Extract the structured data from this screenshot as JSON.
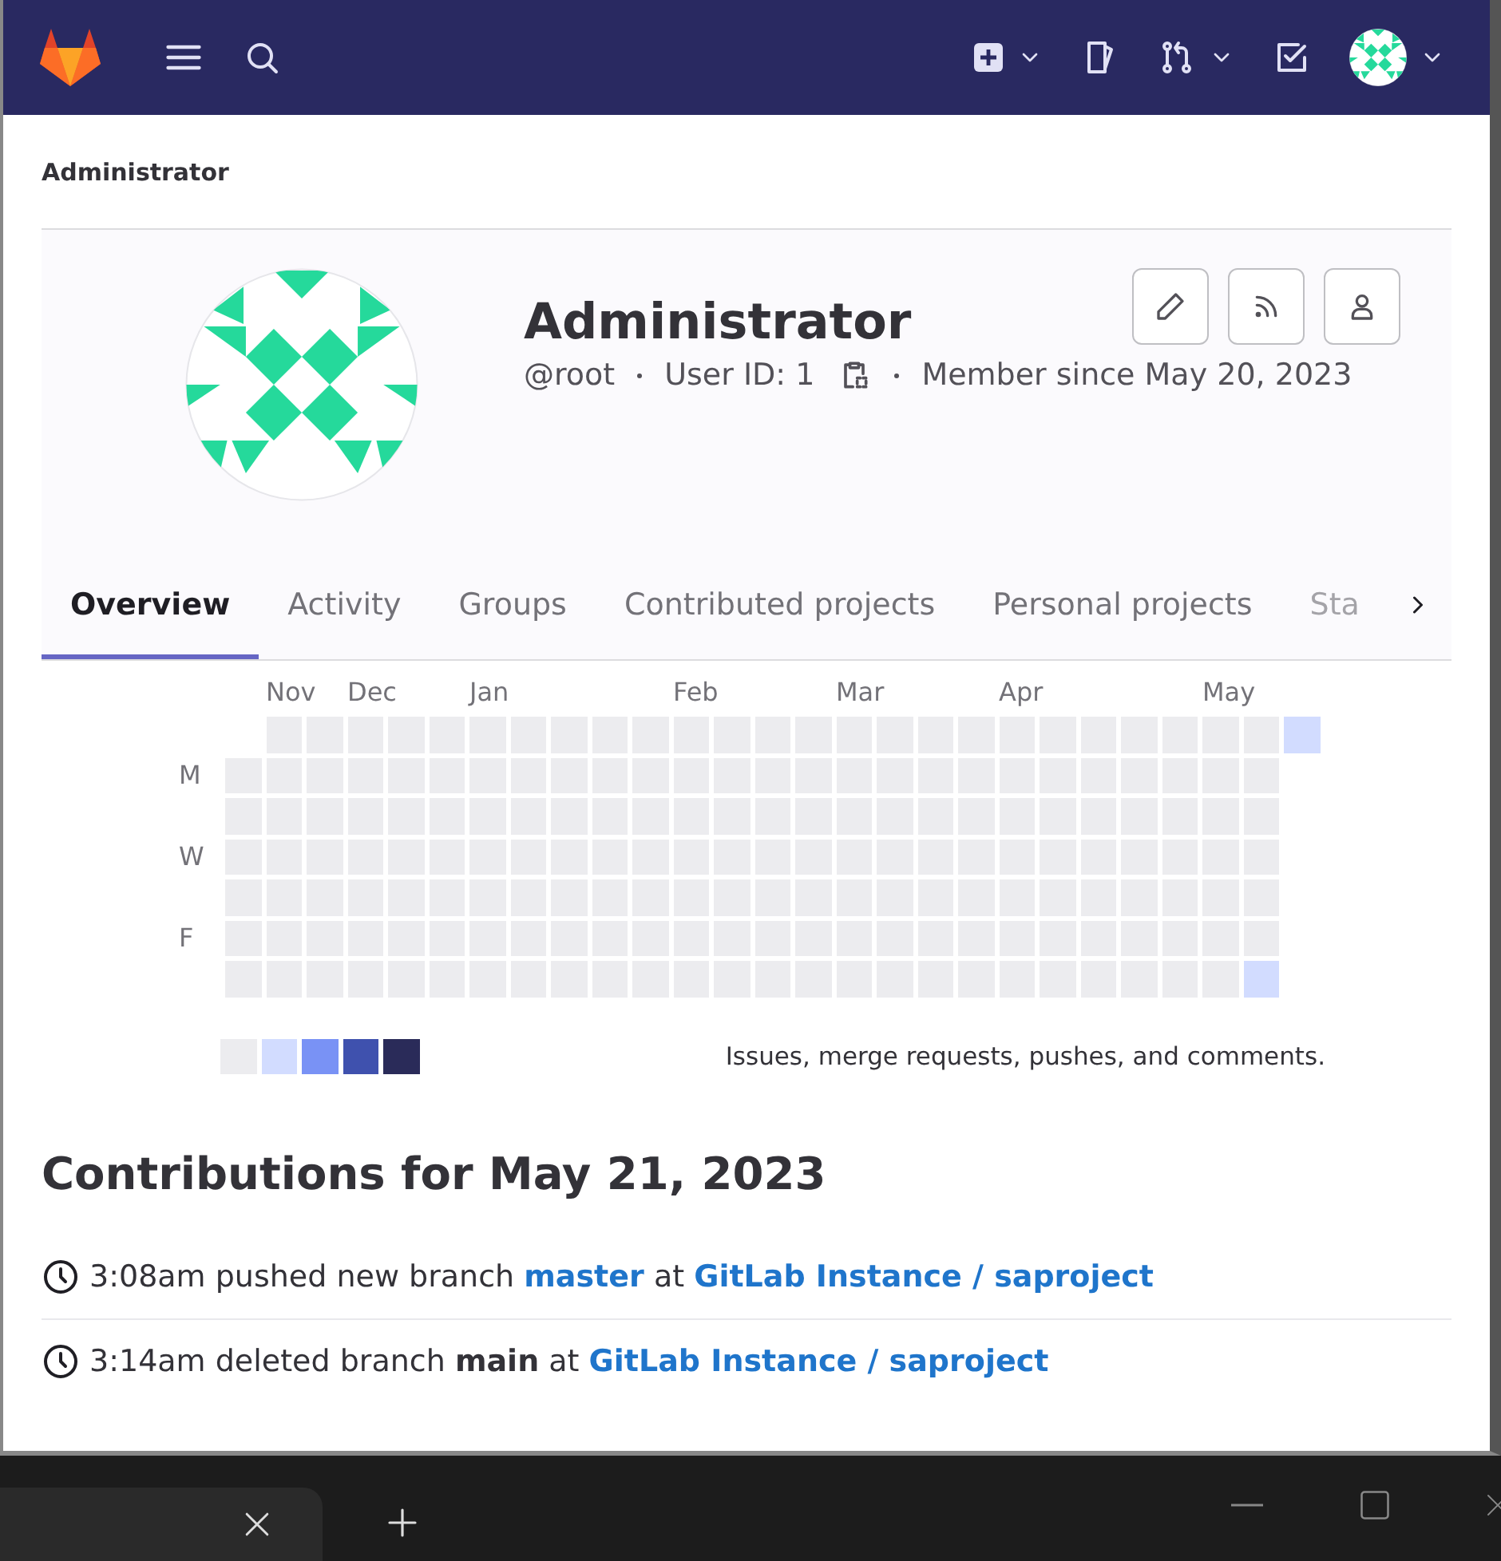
{
  "breadcrumb": "Administrator",
  "profile": {
    "name": "Administrator",
    "username": "@root",
    "user_id": "User ID: 1",
    "member_since": "Member since May 20, 2023"
  },
  "tabs": [
    {
      "label": "Overview",
      "selected": true
    },
    {
      "label": "Activity",
      "selected": false
    },
    {
      "label": "Groups",
      "selected": false
    },
    {
      "label": "Contributed projects",
      "selected": false
    },
    {
      "label": "Personal projects",
      "selected": false
    },
    {
      "label": "Sta",
      "selected": false
    }
  ],
  "calendar": {
    "day_labels": [
      "M",
      "W",
      "F"
    ],
    "weeks": [
      {
        "days": [
          {
            "color": "#ececef"
          },
          {
            "color": "#ececef"
          },
          {
            "color": "#ececef"
          },
          {
            "color": "#ececef"
          },
          {
            "color": "#ececef"
          },
          {
            "color": "#ececef"
          }
        ]
      },
      {
        "month": "Nov",
        "days": [
          {
            "color": "#ececef"
          },
          {
            "color": "#ececef"
          },
          {
            "color": "#ececef"
          },
          {
            "color": "#ececef"
          },
          {
            "color": "#ececef"
          },
          {
            "color": "#ececef"
          },
          {
            "color": "#ececef"
          }
        ]
      },
      {
        "days": [
          {
            "color": "#ececef"
          },
          {
            "color": "#ececef"
          },
          {
            "color": "#ececef"
          },
          {
            "color": "#ececef"
          },
          {
            "color": "#ececef"
          },
          {
            "color": "#ececef"
          },
          {
            "color": "#ececef"
          }
        ]
      },
      {
        "month": "Dec",
        "days": [
          {
            "color": "#ececef"
          },
          {
            "color": "#ececef"
          },
          {
            "color": "#ececef"
          },
          {
            "color": "#ececef"
          },
          {
            "color": "#ececef"
          },
          {
            "color": "#ececef"
          },
          {
            "color": "#ececef"
          }
        ]
      },
      {
        "days": [
          {
            "color": "#ececef"
          },
          {
            "color": "#ececef"
          },
          {
            "color": "#ececef"
          },
          {
            "color": "#ececef"
          },
          {
            "color": "#ececef"
          },
          {
            "color": "#ececef"
          },
          {
            "color": "#ececef"
          }
        ]
      },
      {
        "days": [
          {
            "color": "#ececef"
          },
          {
            "color": "#ececef"
          },
          {
            "color": "#ececef"
          },
          {
            "color": "#ececef"
          },
          {
            "color": "#ececef"
          },
          {
            "color": "#ececef"
          },
          {
            "color": "#ececef"
          }
        ]
      },
      {
        "month": "Jan",
        "days": [
          {
            "color": "#ececef"
          },
          {
            "color": "#ececef"
          },
          {
            "color": "#ececef"
          },
          {
            "color": "#ececef"
          },
          {
            "color": "#ececef"
          },
          {
            "color": "#ececef"
          },
          {
            "color": "#ececef"
          }
        ]
      },
      {
        "days": [
          {
            "color": "#ececef"
          },
          {
            "color": "#ececef"
          },
          {
            "color": "#ececef"
          },
          {
            "color": "#ececef"
          },
          {
            "color": "#ececef"
          },
          {
            "color": "#ececef"
          },
          {
            "color": "#ececef"
          }
        ]
      },
      {
        "days": [
          {
            "color": "#ececef"
          },
          {
            "color": "#ececef"
          },
          {
            "color": "#ececef"
          },
          {
            "color": "#ececef"
          },
          {
            "color": "#ececef"
          },
          {
            "color": "#ececef"
          },
          {
            "color": "#ececef"
          }
        ]
      },
      {
        "days": [
          {
            "color": "#ececef"
          },
          {
            "color": "#ececef"
          },
          {
            "color": "#ececef"
          },
          {
            "color": "#ececef"
          },
          {
            "color": "#ececef"
          },
          {
            "color": "#ececef"
          },
          {
            "color": "#ececef"
          }
        ]
      },
      {
        "days": [
          {
            "color": "#ececef"
          },
          {
            "color": "#ececef"
          },
          {
            "color": "#ececef"
          },
          {
            "color": "#ececef"
          },
          {
            "color": "#ececef"
          },
          {
            "color": "#ececef"
          },
          {
            "color": "#ececef"
          }
        ]
      },
      {
        "month": "Feb",
        "days": [
          {
            "color": "#ececef"
          },
          {
            "color": "#ececef"
          },
          {
            "color": "#ececef"
          },
          {
            "color": "#ececef"
          },
          {
            "color": "#ececef"
          },
          {
            "color": "#ececef"
          },
          {
            "color": "#ececef"
          }
        ]
      },
      {
        "days": [
          {
            "color": "#ececef"
          },
          {
            "color": "#ececef"
          },
          {
            "color": "#ececef"
          },
          {
            "color": "#ececef"
          },
          {
            "color": "#ececef"
          },
          {
            "color": "#ececef"
          },
          {
            "color": "#ececef"
          }
        ]
      },
      {
        "days": [
          {
            "color": "#ececef"
          },
          {
            "color": "#ececef"
          },
          {
            "color": "#ececef"
          },
          {
            "color": "#ececef"
          },
          {
            "color": "#ececef"
          },
          {
            "color": "#ececef"
          },
          {
            "color": "#ececef"
          }
        ]
      },
      {
        "days": [
          {
            "color": "#ececef"
          },
          {
            "color": "#ececef"
          },
          {
            "color": "#ececef"
          },
          {
            "color": "#ececef"
          },
          {
            "color": "#ececef"
          },
          {
            "color": "#ececef"
          },
          {
            "color": "#ececef"
          }
        ]
      },
      {
        "month": "Mar",
        "days": [
          {
            "color": "#ececef"
          },
          {
            "color": "#ececef"
          },
          {
            "color": "#ececef"
          },
          {
            "color": "#ececef"
          },
          {
            "color": "#ececef"
          },
          {
            "color": "#ececef"
          },
          {
            "color": "#ececef"
          }
        ]
      },
      {
        "days": [
          {
            "color": "#ececef"
          },
          {
            "color": "#ececef"
          },
          {
            "color": "#ececef"
          },
          {
            "color": "#ececef"
          },
          {
            "color": "#ececef"
          },
          {
            "color": "#ececef"
          },
          {
            "color": "#ececef"
          }
        ]
      },
      {
        "days": [
          {
            "color": "#ececef"
          },
          {
            "color": "#ececef"
          },
          {
            "color": "#ececef"
          },
          {
            "color": "#ececef"
          },
          {
            "color": "#ececef"
          },
          {
            "color": "#ececef"
          },
          {
            "color": "#ececef"
          }
        ]
      },
      {
        "days": [
          {
            "color": "#ececef"
          },
          {
            "color": "#ececef"
          },
          {
            "color": "#ececef"
          },
          {
            "color": "#ececef"
          },
          {
            "color": "#ececef"
          },
          {
            "color": "#ececef"
          },
          {
            "color": "#ececef"
          }
        ]
      },
      {
        "month": "Apr",
        "days": [
          {
            "color": "#ececef"
          },
          {
            "color": "#ececef"
          },
          {
            "color": "#ececef"
          },
          {
            "color": "#ececef"
          },
          {
            "color": "#ececef"
          },
          {
            "color": "#ececef"
          },
          {
            "color": "#ececef"
          }
        ]
      },
      {
        "days": [
          {
            "color": "#ececef"
          },
          {
            "color": "#ececef"
          },
          {
            "color": "#ececef"
          },
          {
            "color": "#ececef"
          },
          {
            "color": "#ececef"
          },
          {
            "color": "#ececef"
          },
          {
            "color": "#ececef"
          }
        ]
      },
      {
        "days": [
          {
            "color": "#ececef"
          },
          {
            "color": "#ececef"
          },
          {
            "color": "#ececef"
          },
          {
            "color": "#ececef"
          },
          {
            "color": "#ececef"
          },
          {
            "color": "#ececef"
          },
          {
            "color": "#ececef"
          }
        ]
      },
      {
        "days": [
          {
            "color": "#ececef"
          },
          {
            "color": "#ececef"
          },
          {
            "color": "#ececef"
          },
          {
            "color": "#ececef"
          },
          {
            "color": "#ececef"
          },
          {
            "color": "#ececef"
          },
          {
            "color": "#ececef"
          }
        ]
      },
      {
        "days": [
          {
            "color": "#ececef"
          },
          {
            "color": "#ececef"
          },
          {
            "color": "#ececef"
          },
          {
            "color": "#ececef"
          },
          {
            "color": "#ececef"
          },
          {
            "color": "#ececef"
          },
          {
            "color": "#ececef"
          }
        ]
      },
      {
        "month": "May",
        "days": [
          {
            "color": "#ececef"
          },
          {
            "color": "#ececef"
          },
          {
            "color": "#ececef"
          },
          {
            "color": "#ececef"
          },
          {
            "color": "#ececef"
          },
          {
            "color": "#ececef"
          },
          {
            "color": "#ececef"
          }
        ]
      },
      {
        "days": [
          {
            "color": "#ececef"
          },
          {
            "color": "#ececef"
          },
          {
            "color": "#ececef"
          },
          {
            "color": "#ececef"
          },
          {
            "color": "#ececef"
          },
          {
            "color": "#ececef"
          },
          {
            "color": "#d2dcff"
          }
        ]
      },
      {
        "days": [
          {
            "color": "#d2dcff"
          }
        ]
      }
    ],
    "legend": [
      {
        "color": "#ececef"
      },
      {
        "color": "#d2dcff"
      },
      {
        "color": "#7992f5"
      },
      {
        "color": "#3f51ae"
      },
      {
        "color": "#2a2b59"
      }
    ],
    "legend_text": "Issues, merge requests, pushes, and comments."
  },
  "contributions": {
    "title": "Contributions for May 21, 2023",
    "events": [
      {
        "time": "3:08am",
        "action": "pushed new branch",
        "ref": "master",
        "ref_link": true,
        "joiner": "at",
        "project": "GitLab Instance / saproject"
      },
      {
        "time": "3:14am",
        "action": "deleted branch",
        "ref": "main",
        "ref_link": false,
        "joiner": "at",
        "project": "GitLab Instance / saproject"
      }
    ]
  }
}
